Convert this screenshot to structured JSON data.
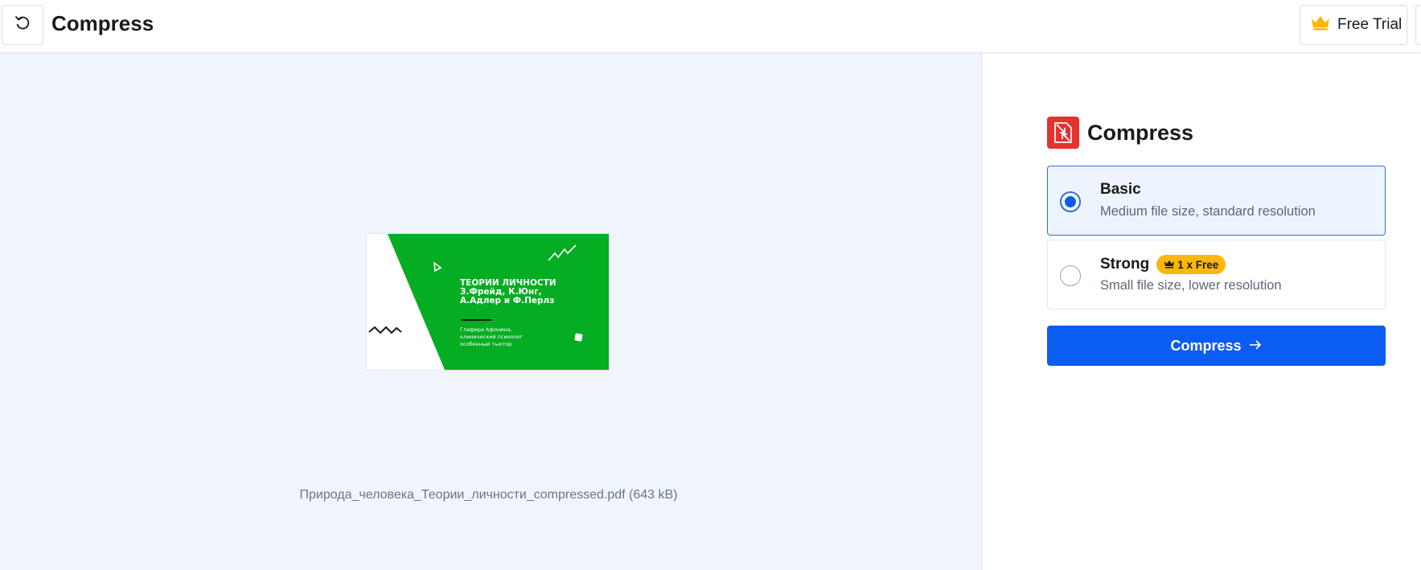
{
  "header": {
    "title": "Compress",
    "back_icon": "undo-icon",
    "free_trial_label": "Free Trial",
    "crown_icon": "crown-icon",
    "crown_color": "#fbb60f"
  },
  "preview": {
    "file_name": "Природа_человека_Теории_личности_compressed.pdf (643 kB)",
    "thumbnail": {
      "title_lines": [
        "ТЕОРИИ ЛИЧНОСТИ",
        "З.Фрейд, К.Юнг,",
        "А.Адлер и Ф.Перлз"
      ],
      "sub_lines": [
        "Глафира Афонина,",
        "клинический психолог",
        "особенный тьютор"
      ],
      "accent_color": "#05ad22"
    }
  },
  "panel": {
    "title": "Compress",
    "tool_icon": "compress-icon",
    "tool_color": "#e5322d",
    "options": [
      {
        "label": "Basic",
        "description": "Medium file size, standard resolution",
        "selected": true
      },
      {
        "label": "Strong",
        "badge": "1 x Free",
        "description": "Small file size, lower resolution",
        "selected": false
      }
    ],
    "compress_button_label": "Compress",
    "primary_color": "#0b5cf0"
  }
}
